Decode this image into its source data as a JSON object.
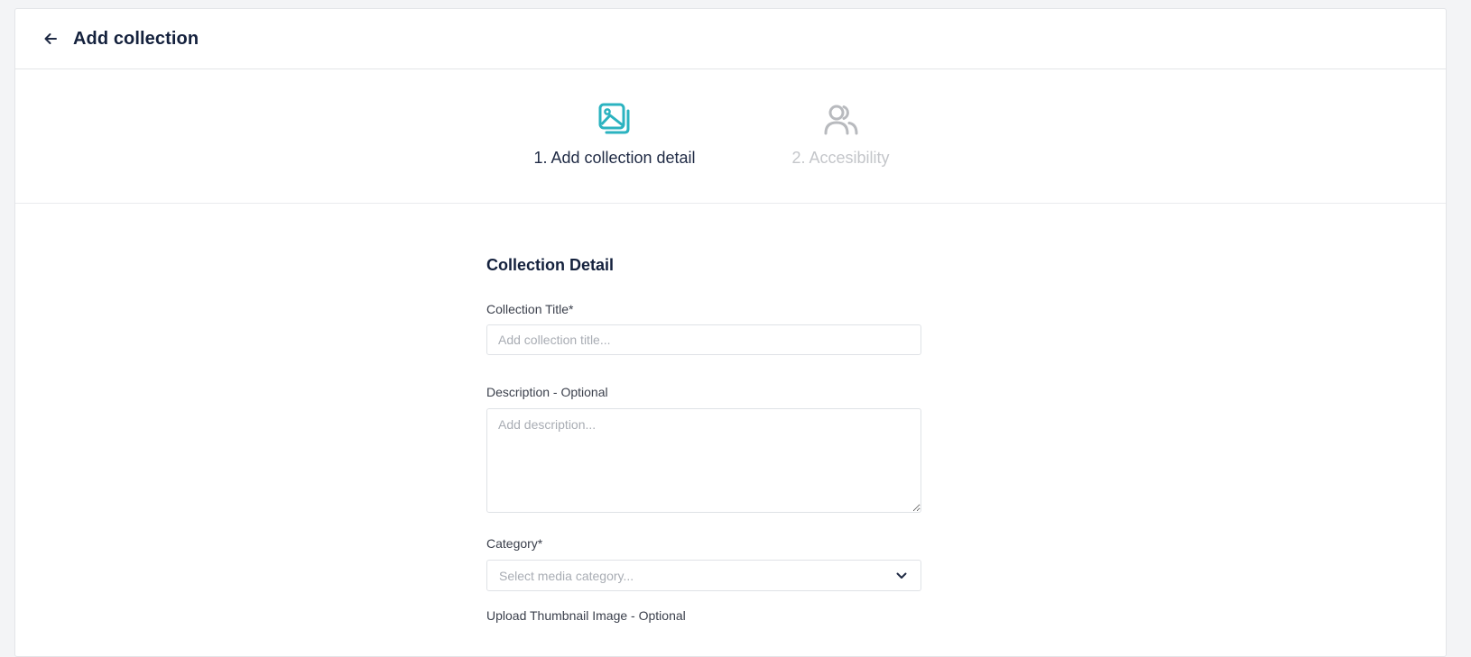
{
  "header": {
    "title": "Add collection",
    "back_icon": "arrow-left-icon"
  },
  "stepper": {
    "steps": [
      {
        "label": "1. Add collection detail",
        "icon": "images-icon",
        "state": "active",
        "color": "#2bb3c0"
      },
      {
        "label": "2. Accesibility",
        "icon": "users-icon",
        "state": "inactive",
        "color": "#b8babe"
      }
    ]
  },
  "form": {
    "section_title": "Collection Detail",
    "title_field": {
      "label": "Collection Title*",
      "placeholder": "Add collection title...",
      "value": ""
    },
    "description_field": {
      "label": "Description - Optional",
      "placeholder": "Add description...",
      "value": ""
    },
    "category_field": {
      "label": "Category*",
      "placeholder": "Select media category...",
      "icon": "chevron-down-icon"
    },
    "next_field": {
      "label": "Upload Thumbnail Image - Optional"
    }
  },
  "colors": {
    "accent": "#2bb3c0",
    "title_text": "#14213d",
    "border": "#dfe2e6"
  }
}
